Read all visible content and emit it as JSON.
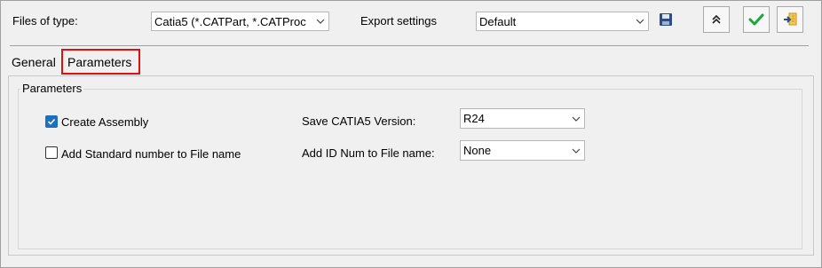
{
  "header": {
    "files_of_type_label": "Files of type:",
    "files_of_type_value": "Catia5 (*.CATPart, *.CATProc",
    "export_settings_label": "Export settings",
    "export_settings_value": "Default"
  },
  "tabs": [
    {
      "label": "General"
    },
    {
      "label": "Parameters"
    }
  ],
  "parameters": {
    "group_title": "Parameters",
    "create_assembly_label": "Create Assembly",
    "create_assembly_checked": true,
    "add_standard_number_label": "Add Standard number to File name",
    "add_standard_number_checked": false,
    "save_version_label": "Save CATIA5 Version:",
    "save_version_value": "R24",
    "add_id_num_label": "Add ID Num to File name:",
    "add_id_num_value": "None"
  },
  "icons": {
    "save": "floppy-disk-icon",
    "collapse": "double-chevron-up-icon",
    "ok": "checkmark-icon",
    "export": "export-icon"
  },
  "colors": {
    "checkbox_checked": "#1f6fbf",
    "tab_highlight": "#e01010",
    "ok_green": "#1aa83a",
    "save_blue": "#2c4c8c"
  }
}
